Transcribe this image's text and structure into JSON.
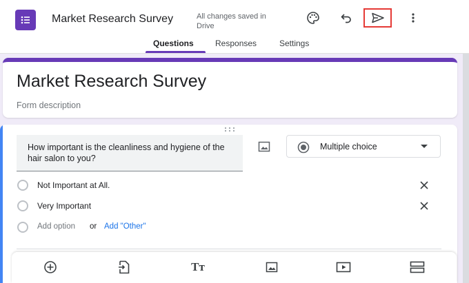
{
  "header": {
    "doc_title": "Market Research Survey",
    "save_status": "All changes saved in Drive",
    "icons": [
      "palette-icon",
      "undo-icon",
      "send-icon",
      "more-vert-icon"
    ]
  },
  "tabs": [
    {
      "label": "Questions",
      "active": true
    },
    {
      "label": "Responses",
      "active": false
    },
    {
      "label": "Settings",
      "active": false
    }
  ],
  "form": {
    "title": "Market Research Survey",
    "description_placeholder": "Form description"
  },
  "question": {
    "text": "How important is the cleanliness and hygiene of the hair salon to you?",
    "type": "Multiple choice",
    "options": [
      "Not Important at All.",
      "Very Important"
    ],
    "add_option": "Add option",
    "or": "or",
    "add_other": "Add \"Other\""
  },
  "toolbar": {
    "icons": [
      "add-question-icon",
      "import-questions-icon",
      "add-title-icon",
      "add-image-icon",
      "add-video-icon",
      "add-section-icon"
    ]
  },
  "colors": {
    "accent": "#673ab7",
    "focus": "#4285f4",
    "link": "#1a73e8",
    "highlight_box": "#e53935"
  }
}
